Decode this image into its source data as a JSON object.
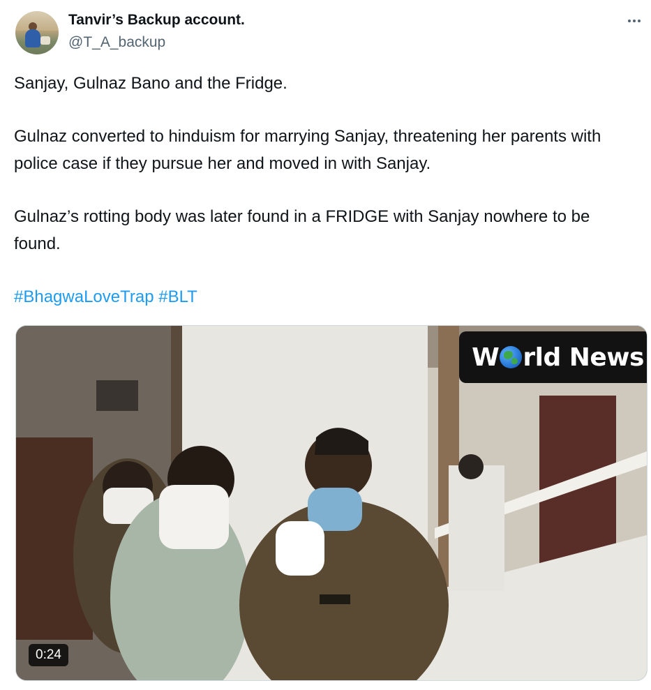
{
  "author": {
    "display_name": "Tanvir’s Backup account.",
    "handle": "@T_A_backup"
  },
  "icons": {
    "avatar": "avatar-photo",
    "more": "more-horizontal-icon"
  },
  "tweet": {
    "paragraphs": [
      "Sanjay, Gulnaz Bano and the Fridge.",
      "Gulnaz converted to hinduism for marrying Sanjay, threatening her parents with police case if they pursue her and moved in with Sanjay.",
      "Gulnaz’s rotting body was later found in a FRIDGE with Sanjay nowhere to be found."
    ],
    "hashtags": [
      "#BhagwaLoveTrap",
      "#BLT"
    ]
  },
  "media": {
    "type": "video",
    "watermark_prefix": "W",
    "watermark_suffix": "rld News",
    "duration": "0:24"
  },
  "colors": {
    "link": "#1d9bf0",
    "secondary_text": "#536471",
    "primary_text": "#0f1419"
  }
}
